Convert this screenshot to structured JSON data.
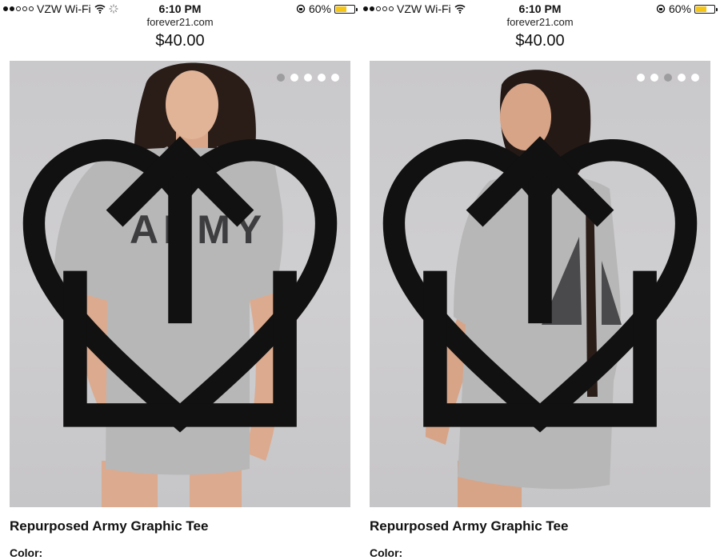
{
  "status_bar": {
    "carrier": "VZW Wi-Fi",
    "time": "6:10 PM",
    "battery_text": "60%",
    "battery_level": 0.6,
    "battery_color": "#f5c518"
  },
  "screens": [
    {
      "url": "forever21.com",
      "price": "$40.00",
      "product_title": "Repurposed Army Graphic Tee",
      "color_label": "Color:",
      "shirt_print": "ARMY",
      "carousel_active_index": 0,
      "carousel_count": 5,
      "icons": [
        "heart-icon",
        "share-icon"
      ]
    },
    {
      "url": "forever21.com",
      "price": "$40.00",
      "product_title": "Repurposed Army Graphic Tee",
      "color_label": "Color:",
      "carousel_active_index": 2,
      "carousel_count": 5,
      "icons": [
        "heart-icon",
        "share-icon"
      ]
    }
  ],
  "colors": {
    "accent_dot_active": "#9d9d9f",
    "photo_background": "#cbcacc",
    "shirt_gray": "#b7b7b8"
  }
}
